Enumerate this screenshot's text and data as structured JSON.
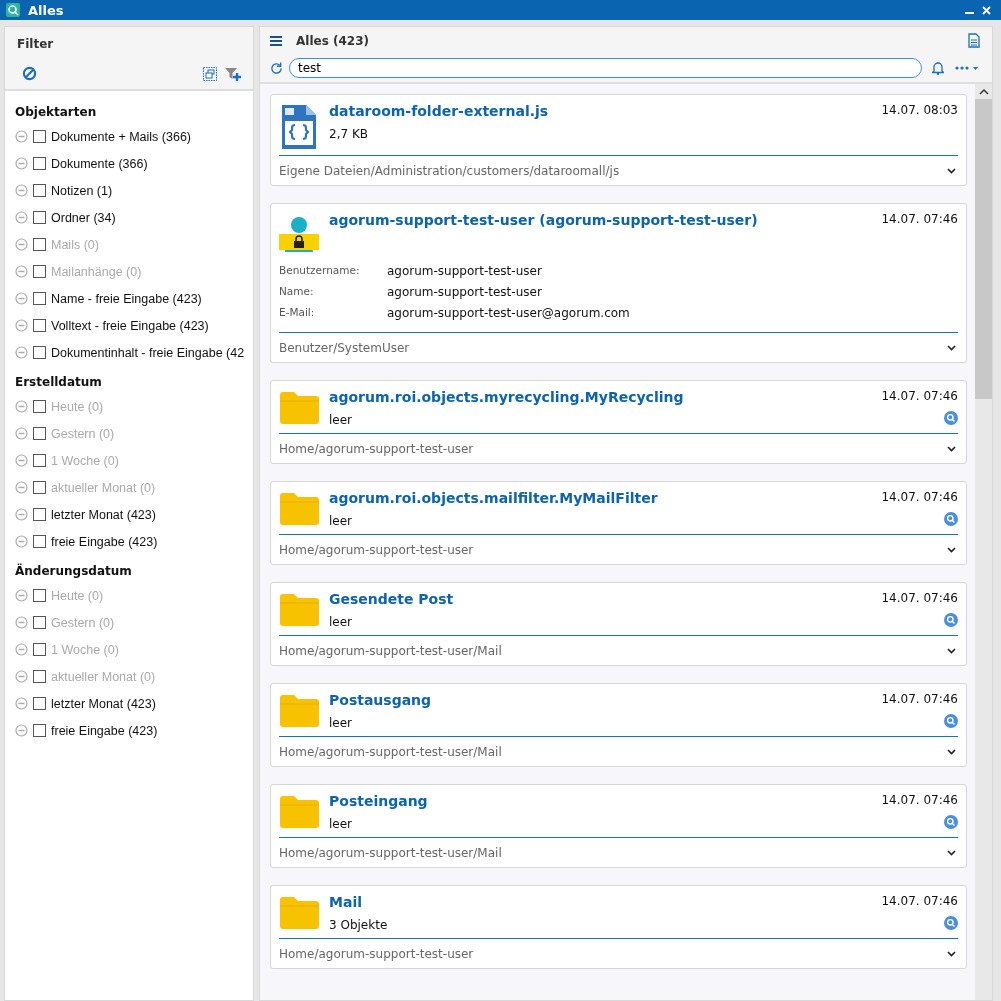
{
  "window": {
    "title": "Alles"
  },
  "filter": {
    "title": "Filter",
    "groups": [
      {
        "title": "Objektarten",
        "items": [
          {
            "label": "Dokumente + Mails (366)",
            "checked": false,
            "disabled": false
          },
          {
            "label": "Dokumente (366)",
            "checked": false,
            "disabled": false
          },
          {
            "label": "Notizen (1)",
            "checked": false,
            "disabled": false
          },
          {
            "label": "Ordner (34)",
            "checked": false,
            "disabled": false
          },
          {
            "label": "Mails (0)",
            "checked": false,
            "disabled": true
          },
          {
            "label": "Mailanhänge (0)",
            "checked": false,
            "disabled": true
          },
          {
            "label": "Name - freie Eingabe (423)",
            "checked": false,
            "disabled": false
          },
          {
            "label": "Volltext - freie Eingabe (423)",
            "checked": false,
            "disabled": false
          },
          {
            "label": "Dokumentinhalt - freie Eingabe (42",
            "checked": false,
            "disabled": false
          }
        ]
      },
      {
        "title": "Erstelldatum",
        "items": [
          {
            "label": "Heute (0)",
            "checked": false,
            "disabled": true
          },
          {
            "label": "Gestern (0)",
            "checked": false,
            "disabled": true
          },
          {
            "label": "1 Woche (0)",
            "checked": false,
            "disabled": true
          },
          {
            "label": "aktueller Monat (0)",
            "checked": false,
            "disabled": true
          },
          {
            "label": "letzter Monat (423)",
            "checked": false,
            "disabled": false
          },
          {
            "label": "freie Eingabe (423)",
            "checked": false,
            "disabled": false
          }
        ]
      },
      {
        "title": "Änderungsdatum",
        "items": [
          {
            "label": "Heute (0)",
            "checked": false,
            "disabled": true
          },
          {
            "label": "Gestern (0)",
            "checked": false,
            "disabled": true
          },
          {
            "label": "1 Woche (0)",
            "checked": false,
            "disabled": true
          },
          {
            "label": "aktueller Monat (0)",
            "checked": false,
            "disabled": true
          },
          {
            "label": "letzter Monat (423)",
            "checked": false,
            "disabled": false
          },
          {
            "label": "freie Eingabe (423)",
            "checked": false,
            "disabled": false
          }
        ]
      }
    ]
  },
  "results": {
    "title": "Alles (423)",
    "search": {
      "value": "test"
    },
    "items": [
      {
        "kind": "file",
        "title": "dataroom-folder-external.js",
        "date": "14.07. 08:03",
        "subtitle": "2,7 KB",
        "path": "Eigene Dateien/Administration/customers/dataroomall/js"
      },
      {
        "kind": "user",
        "title": "agorum-support-test-user (agorum-support-test-user)",
        "date": "14.07. 07:46",
        "fields": [
          {
            "label": "Benutzername:",
            "value": "agorum-support-test-user"
          },
          {
            "label": "Name:",
            "value": "agorum-support-test-user"
          },
          {
            "label": "E-Mail:",
            "value": "agorum-support-test-user@agorum.com"
          }
        ],
        "path": "Benutzer/SystemUser"
      },
      {
        "kind": "folder",
        "title": "agorum.roi.objects.myrecycling.MyRecycling",
        "date": "14.07. 07:46",
        "subtitle": "leer",
        "path": "Home/agorum-support-test-user"
      },
      {
        "kind": "folder",
        "title": "agorum.roi.objects.mailfilter.MyMailFilter",
        "date": "14.07. 07:46",
        "subtitle": "leer",
        "path": "Home/agorum-support-test-user"
      },
      {
        "kind": "folder",
        "title": "Gesendete Post",
        "date": "14.07. 07:46",
        "subtitle": "leer",
        "path": "Home/agorum-support-test-user/Mail"
      },
      {
        "kind": "folder",
        "title": "Postausgang",
        "date": "14.07. 07:46",
        "subtitle": "leer",
        "path": "Home/agorum-support-test-user/Mail"
      },
      {
        "kind": "folder",
        "title": "Posteingang",
        "date": "14.07. 07:46",
        "subtitle": "leer",
        "path": "Home/agorum-support-test-user/Mail"
      },
      {
        "kind": "folder",
        "title": "Mail",
        "date": "14.07. 07:46",
        "subtitle": "3 Objekte",
        "path": "Home/agorum-support-test-user"
      }
    ]
  }
}
